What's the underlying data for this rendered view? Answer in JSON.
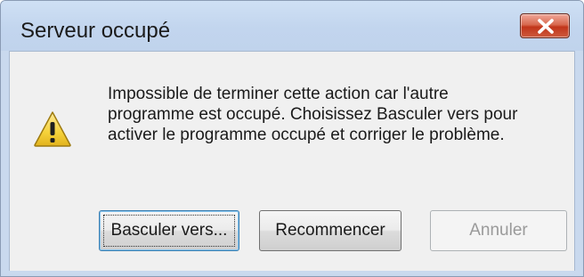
{
  "window": {
    "title": "Serveur occupé"
  },
  "dialog": {
    "message": "Impossible de terminer cette action car l'autre\nprogramme est occupé. Choisissez Basculer vers pour\nactiver le programme occupé et corriger le problème.",
    "icon": "warning-icon"
  },
  "buttons": {
    "switch_label": "Basculer vers...",
    "retry_label": "Recommencer",
    "cancel_label": "Annuler"
  },
  "colors": {
    "title_bar": "#c9d9ee",
    "close_button": "#c7432a",
    "warning_fill": "#f5d23a"
  }
}
